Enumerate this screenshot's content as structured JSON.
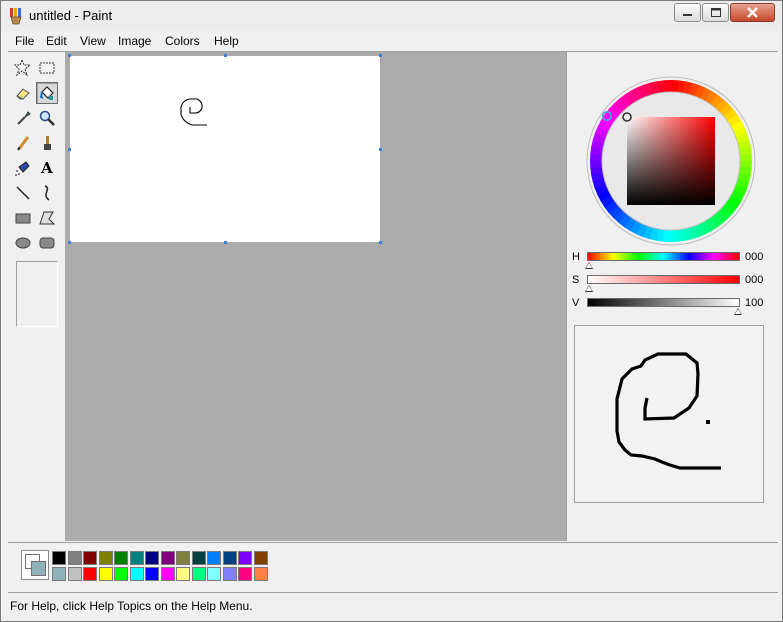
{
  "window": {
    "title": "untitled - Paint"
  },
  "menu": [
    "File",
    "Edit",
    "View",
    "Image",
    "Colors",
    "Help"
  ],
  "tools": [
    {
      "name": "free-form-select"
    },
    {
      "name": "rectangle-select"
    },
    {
      "name": "eraser"
    },
    {
      "name": "fill",
      "active": true
    },
    {
      "name": "color-picker"
    },
    {
      "name": "magnifier"
    },
    {
      "name": "pencil"
    },
    {
      "name": "brush"
    },
    {
      "name": "airbrush"
    },
    {
      "name": "text"
    },
    {
      "name": "line"
    },
    {
      "name": "curve"
    },
    {
      "name": "rectangle"
    },
    {
      "name": "polygon"
    },
    {
      "name": "ellipse"
    },
    {
      "name": "rounded-rectangle"
    }
  ],
  "text_tool_glyph": "A",
  "color_picker": {
    "h_label": "H",
    "h_value": "000",
    "s_label": "S",
    "s_value": "000",
    "v_label": "V",
    "v_value": "100",
    "hue": 0,
    "saturation": 0,
    "value": 100
  },
  "palette": {
    "foreground": "#ffffff",
    "background": "#8fb2b8",
    "row1": [
      "#000000",
      "#808080",
      "#800000",
      "#808000",
      "#008000",
      "#008080",
      "#000080",
      "#800080",
      "#808040",
      "#004040",
      "#0080ff",
      "#004080",
      "#8000ff",
      "#804000"
    ],
    "row2": [
      "#8fb2b8",
      "#c0c0c0",
      "#ff0000",
      "#ffff00",
      "#00ff00",
      "#00ffff",
      "#0000ff",
      "#ff00ff",
      "#ffff80",
      "#00ff80",
      "#80ffff",
      "#8080ff",
      "#ff0080",
      "#ff8040"
    ]
  },
  "status": {
    "text": "For Help, click Help Topics on the Help Menu."
  }
}
